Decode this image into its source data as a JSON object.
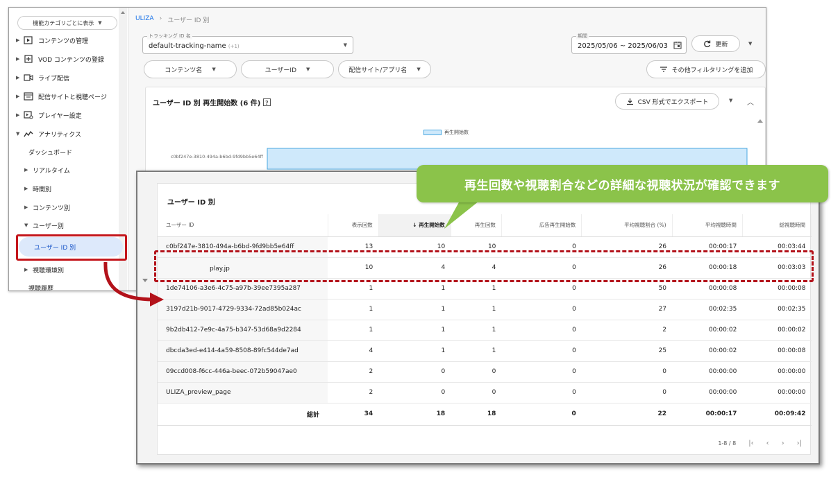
{
  "sidebar": {
    "category_select": "機能カテゴリごとに表示",
    "items": [
      {
        "label": "コンテンツの管理",
        "icon": "play-box-icon"
      },
      {
        "label": "VOD コンテンツの登録",
        "icon": "add-box-icon"
      },
      {
        "label": "ライブ配信",
        "icon": "camera-icon"
      },
      {
        "label": "配信サイトと視聴ページ",
        "icon": "browser-icon"
      },
      {
        "label": "プレイヤー設定",
        "icon": "player-settings-icon"
      },
      {
        "label": "アナリティクス",
        "icon": "analytics-icon"
      }
    ],
    "analytics_sub": {
      "dashboard": "ダッシュボード",
      "realtime": "リアルタイム",
      "by_time": "時間別",
      "by_content": "コンテンツ別",
      "by_user": "ユーザー別",
      "by_user_id": "ユーザー ID 別",
      "by_env": "視聴環境別",
      "history": "視聴履歴"
    }
  },
  "breadcrumb": {
    "home": "ULIZA",
    "sep": "›",
    "current": "ユーザー ID 別"
  },
  "filters": {
    "tracking_label": "トラッキング ID 名",
    "tracking_value": "default-tracking-name",
    "tracking_extra": "(+1)",
    "period_label": "期間",
    "period_value": "2025/05/06 ~ 2025/06/03",
    "refresh_label": "更新",
    "pill_content": "コンテンツ名",
    "pill_user": "ユーザーID",
    "pill_site": "配信サイト/アプリ名",
    "add_filter": "その他フィルタリングを追加"
  },
  "chart_card": {
    "title": "ユーザー ID 別 再生開始数 (6 件)",
    "export": "CSV 形式でエクスポート",
    "legend": "再生開始数",
    "row_label": "c0bf247e-3810-494a-b6bd-9fd9bb5e64ff"
  },
  "chart_data": {
    "type": "bar",
    "categories": [
      "c0bf247e-3810-494a-b6bd-9fd9bb5e64ff"
    ],
    "series": [
      {
        "name": "再生開始数",
        "values": [
          10
        ]
      }
    ],
    "orientation": "horizontal"
  },
  "table_card": {
    "title": "ユーザー ID 別",
    "headers": [
      "ユーザー ID",
      "表示回数",
      "再生開始数",
      "再生回数",
      "広告再生開始数",
      "平均視聴割合 (%)",
      "平均視聴時間",
      "総視聴時間"
    ],
    "sort_icon": "arrow-down-icon",
    "rows": [
      [
        "c0bf247e-3810-494a-b6bd-9fd9bb5e64ff",
        "13",
        "10",
        "10",
        "0",
        "26",
        "00:00:17",
        "00:03:44"
      ],
      [
        "play.jp",
        "10",
        "4",
        "4",
        "0",
        "26",
        "00:00:18",
        "00:03:03"
      ],
      [
        "1de74106-a3e6-4c75-a97b-39ee7395a287",
        "1",
        "1",
        "1",
        "0",
        "50",
        "00:00:08",
        "00:00:08"
      ],
      [
        "3197d21b-9017-4729-9334-72ad85b024ac",
        "1",
        "1",
        "1",
        "0",
        "27",
        "00:02:35",
        "00:02:35"
      ],
      [
        "9b2db412-7e9c-4a75-b347-53d68a9d2284",
        "1",
        "1",
        "1",
        "0",
        "2",
        "00:00:02",
        "00:00:02"
      ],
      [
        "dbcda3ed-e414-4a59-8508-89fc544de7ad",
        "4",
        "1",
        "1",
        "0",
        "25",
        "00:00:02",
        "00:00:08"
      ],
      [
        "09ccd008-f6cc-446a-beec-072b59047ae0",
        "2",
        "0",
        "0",
        "0",
        "0",
        "00:00:00",
        "00:00:00"
      ],
      [
        "ULIZA_preview_page",
        "2",
        "0",
        "0",
        "0",
        "0",
        "00:00:00",
        "00:00:00"
      ]
    ],
    "total": [
      "総計",
      "34",
      "18",
      "18",
      "0",
      "22",
      "00:00:17",
      "00:09:42"
    ],
    "pager": "1-8 / 8"
  },
  "callout": "再生回数や視聴割合などの詳細な視聴状況が確認できます",
  "colors": {
    "accent": "#1a73e8",
    "callout": "#8bc34a",
    "highlight": "#b3121a",
    "bar_fill": "#cfe9fb",
    "bar_stroke": "#4aa8e0"
  }
}
